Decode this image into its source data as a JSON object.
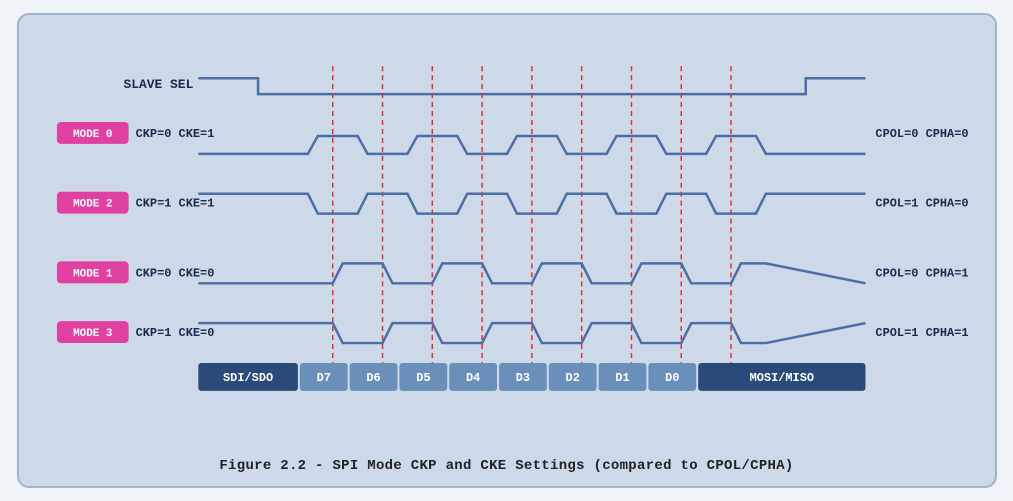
{
  "caption": "Figure 2.2 - SPI Mode CKP and CKE Settings (compared to CPOL/CPHA)",
  "diagram": {
    "slave_sel_label": "SLAVE SEL",
    "modes": [
      {
        "label": "MODE 0",
        "params": "CKP=0  CKE=1",
        "right": "CPOL=0  CPHA=0"
      },
      {
        "label": "MODE 2",
        "params": "CKP=1  CKE=1",
        "right": "CPOL=1  CPHA=0"
      },
      {
        "label": "MODE 1",
        "params": "CKP=0  CKE=0",
        "right": "CPOL=0  CPHA=1"
      },
      {
        "label": "MODE 3",
        "params": "CKP=1  CKE=0",
        "right": "CPOL=1  CPHA=1"
      }
    ],
    "data_labels": [
      "SDI/SDO",
      "D7",
      "D6",
      "D5",
      "D4",
      "D3",
      "D2",
      "D1",
      "D0",
      "MOSI/MISO"
    ]
  }
}
